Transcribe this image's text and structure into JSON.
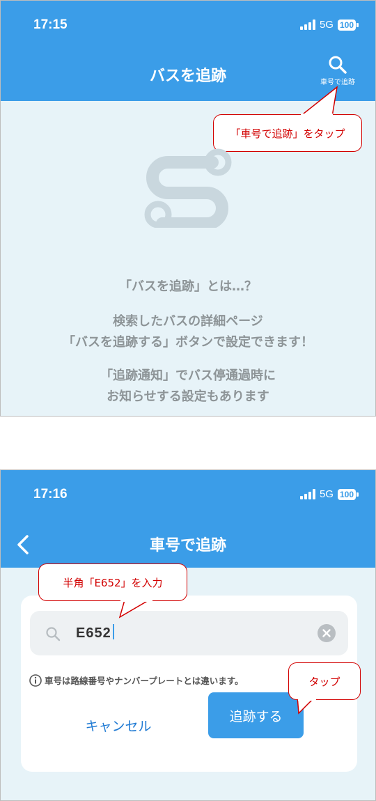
{
  "screen1": {
    "status": {
      "time": "17:15",
      "network": "5G",
      "battery": "100"
    },
    "nav": {
      "title": "バスを追跡",
      "search_label": "車号で追跡",
      "search_icon": "search-icon"
    },
    "empty_state": {
      "icon": "route-icon",
      "heading": "「バスを追跡」とは…？",
      "line1": "検索したバスの詳細ページ",
      "line2": "「バスを追跡する」ボタンで設定できます！",
      "line3": "「追跡通知」でバス停通過時に",
      "line4": "お知らせする設定もあります"
    },
    "callout": "「車号で追跡」をタップ"
  },
  "screen2": {
    "status": {
      "time": "17:16",
      "network": "5G",
      "battery": "100"
    },
    "nav": {
      "title": "車号で追跡",
      "back_icon": "chevron-left-icon"
    },
    "dialog": {
      "input_value": "E652",
      "note": "車号は路線番号やナンバープレートとは違います。",
      "cancel_label": "キャンセル",
      "track_label": "追跡する"
    },
    "callout_input": "半角「E652」を入力",
    "callout_tap": "タップ"
  },
  "colors": {
    "primary": "#3b9de8",
    "background": "#e7f3f8",
    "callout": "#d20000"
  }
}
